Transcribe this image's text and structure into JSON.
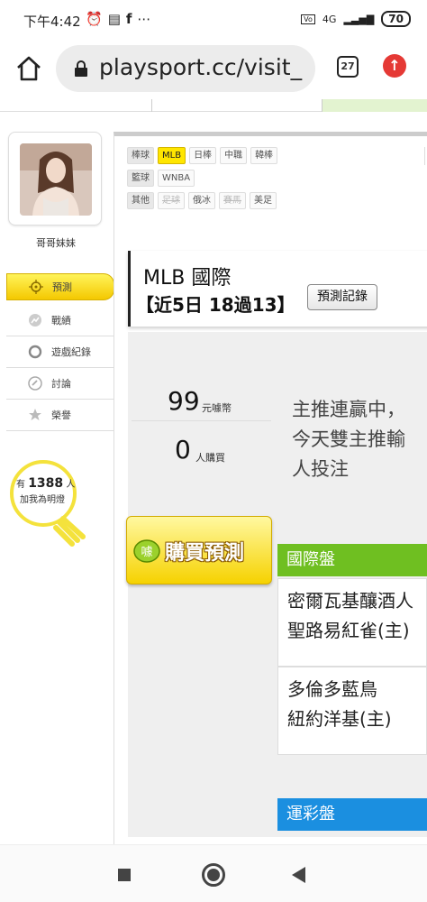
{
  "status_bar": {
    "time": "下午4:42",
    "icons": [
      "alarm-icon",
      "news-icon",
      "facebook-icon",
      "more-icon"
    ],
    "network": "4G",
    "battery": "70"
  },
  "browser": {
    "url": "playsport.cc/visit_",
    "tab_count": "27"
  },
  "profile": {
    "username": "哥哥妹妹"
  },
  "side_menu": [
    {
      "label": "預測",
      "icon": "target-icon",
      "active": true
    },
    {
      "label": "戰績",
      "icon": "chart-icon",
      "active": false
    },
    {
      "label": "遊戲紀錄",
      "icon": "record-icon",
      "active": false
    },
    {
      "label": "討論",
      "icon": "chat-icon",
      "active": false
    },
    {
      "label": "榮譽",
      "icon": "medal-icon",
      "active": false
    }
  ],
  "bulb": {
    "prefix": "有",
    "count": "1388",
    "suffix": "人",
    "line2": "加我為明燈"
  },
  "filters": [
    {
      "category": "棒球",
      "tags": [
        {
          "label": "MLB",
          "state": "selected"
        },
        {
          "label": "日棒",
          "state": "normal"
        },
        {
          "label": "中職",
          "state": "normal"
        },
        {
          "label": "韓棒",
          "state": "normal"
        }
      ]
    },
    {
      "category": "籃球",
      "tags": [
        {
          "label": "WNBA",
          "state": "normal"
        }
      ]
    },
    {
      "category": "其他",
      "tags": [
        {
          "label": "足球",
          "state": "disabled"
        },
        {
          "label": "俄冰",
          "state": "normal"
        },
        {
          "label": "賽馬",
          "state": "disabled"
        },
        {
          "label": "美足",
          "state": "normal"
        }
      ]
    }
  ],
  "title_box": {
    "title": "MLB 國際",
    "streak": "【近5日 18過13】",
    "record_button": "預測記錄"
  },
  "stats": {
    "price": "99",
    "price_unit": "元噱幣",
    "buyers": "0",
    "buyers_unit": "人購買"
  },
  "buy_button": {
    "label": "購買預測",
    "badge": "噱"
  },
  "description": [
    "主推連贏中，",
    "今天雙主推輸",
    "人投注"
  ],
  "sections": {
    "international": {
      "header": "國際盤",
      "matches": [
        {
          "line1": "密爾瓦基釀酒人",
          "line2": "聖路易紅雀(主)"
        },
        {
          "line1": "多倫多藍鳥",
          "line2": "紐約洋基(主)"
        }
      ]
    },
    "sports_lottery": {
      "header": "運彩盤"
    }
  },
  "colors": {
    "accent_yellow": "#ffe600",
    "section_green": "#6fbf21",
    "section_blue": "#1b8fe0",
    "update_red": "#e53935"
  }
}
